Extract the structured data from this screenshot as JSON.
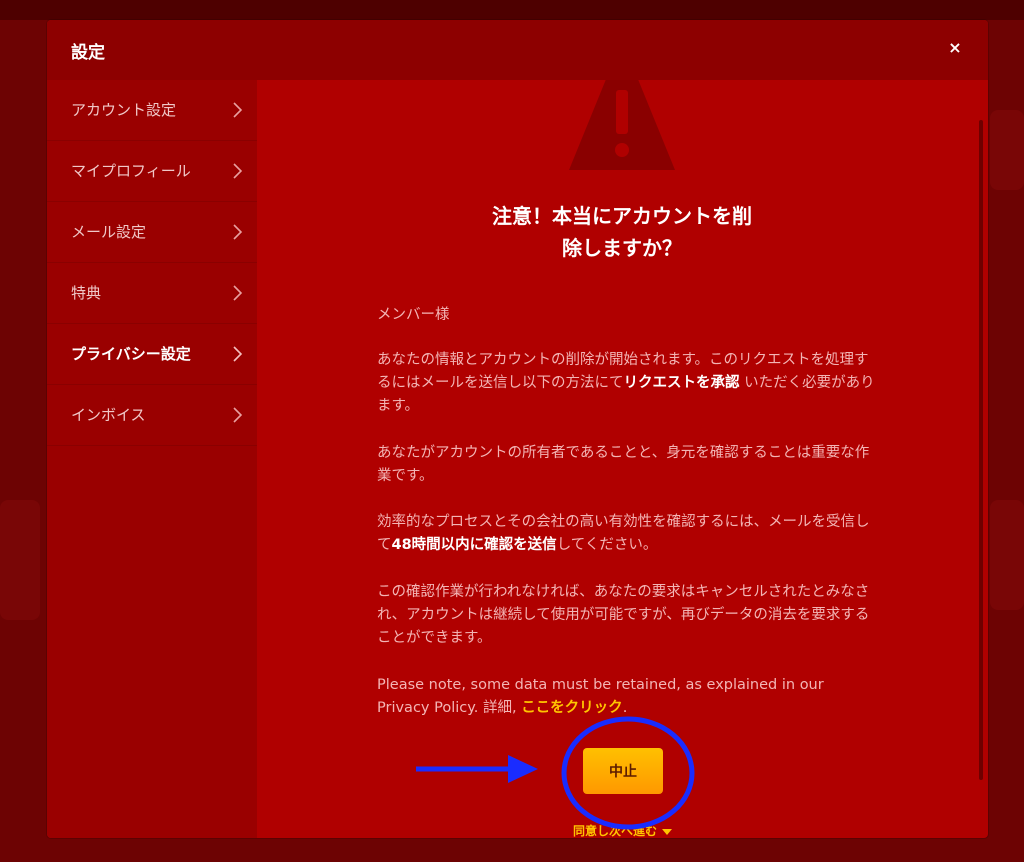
{
  "modal": {
    "title": "設定",
    "close_glyph": "×"
  },
  "sidebar": {
    "items": [
      {
        "label": "アカウント設定",
        "active": false
      },
      {
        "label": "マイプロフィール",
        "active": false
      },
      {
        "label": "メール設定",
        "active": false
      },
      {
        "label": "特典",
        "active": false
      },
      {
        "label": "プライバシー設定",
        "active": true
      },
      {
        "label": "インボイス",
        "active": false
      }
    ]
  },
  "content": {
    "heading_line1": "注意！本当にアカウントを削",
    "heading_line2": "除しますか？",
    "greeting": "メンバー様",
    "p1_before": "あなたの情報とアカウントの削除が開始されます。このリクエストを処理するにはメールを送信し以下の方法にて",
    "p1_bold": "リクエストを承認",
    "p1_after": " いただく必要があります。",
    "p2": "あなたがアカウントの所有者であることと、身元を確認することは重要な作業です。",
    "p3_before": "効率的なプロセスとその会社の高い有効性を確認するには、メールを受信して",
    "p3_bold": "48時間以内に確認を送信",
    "p3_after": "してください。",
    "p4": "この確認作業が行われなければ、あなたの要求はキャンセルされたとみなされ、アカウントは継続して使用が可能ですが、再びデータの消去を要求することができます。",
    "p5_text": "Please note, some data must be retained, as explained in our Privacy Policy. 詳細, ",
    "p5_link": "ここをクリック",
    "p5_end": ".",
    "cancel_label": "中止",
    "agree_label": "同意し次へ進む"
  },
  "colors": {
    "modal_bg": "#b00000",
    "header_bg": "#8d0000",
    "sidebar_bg": "#9a0000",
    "accent": "#ffc000",
    "annotation": "#1a2cff"
  }
}
